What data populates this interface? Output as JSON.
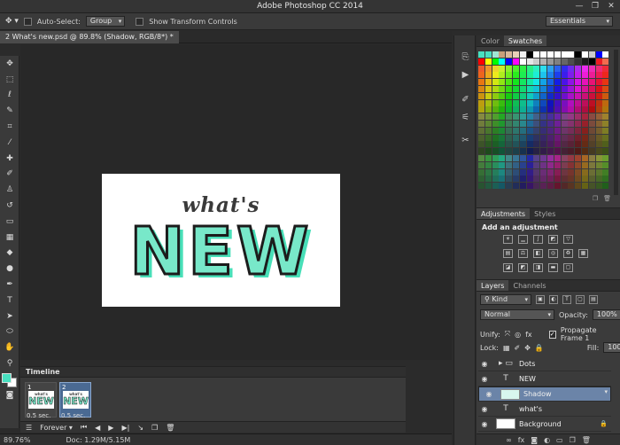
{
  "app": {
    "title": "Adobe Photoshop CC 2014",
    "window_controls": [
      "—",
      "❐",
      "✕"
    ]
  },
  "options_bar": {
    "auto_select_label": "Auto-Select:",
    "auto_select_value": "Group",
    "transform_label": "Show Transform Controls",
    "workspace": "Essentials"
  },
  "document": {
    "tab_label": "2 What's new.psd @ 89.8% (Shadow, RGB/8*) *",
    "art_line1": "what's",
    "art_line2": "NEW"
  },
  "tools": [
    "move-icon",
    "marquee-icon",
    "lasso-icon",
    "quick-select-icon",
    "crop-icon",
    "eyedropper-icon",
    "healing-icon",
    "brush-icon",
    "stamp-icon",
    "history-brush-icon",
    "eraser-icon",
    "gradient-icon",
    "blur-icon",
    "dodge-icon",
    "pen-icon",
    "type-icon",
    "path-select-icon",
    "shape-icon",
    "hand-icon",
    "zoom-icon"
  ],
  "colors": {
    "foreground": "#48e0c0",
    "background": "#ffffff",
    "accent_selected": "#6b84a8"
  },
  "timeline": {
    "title": "Timeline",
    "frames": [
      {
        "num": "1",
        "delay": "0.5 sec.",
        "thumb_top": "what's",
        "thumb_main": "NEW"
      },
      {
        "num": "2",
        "delay": "0.5 sec.",
        "thumb_top": "what's",
        "thumb_main": "NEW"
      }
    ],
    "loop": "Forever"
  },
  "status": {
    "zoom": "89.76%",
    "doc": "Doc: 1.29M/5.15M"
  },
  "color_panel": {
    "tab_color": "Color",
    "tab_swatches": "Swatches"
  },
  "adjustments": {
    "tab_adjustments": "Adjustments",
    "tab_styles": "Styles",
    "heading": "Add an adjustment"
  },
  "layers_panel": {
    "tab_layers": "Layers",
    "tab_channels": "Channels",
    "filter_kind": "Kind",
    "blend_mode": "Normal",
    "opacity_label": "Opacity:",
    "opacity_value": "100%",
    "unify_label": "Unify:",
    "propagate_label": "Propagate Frame 1",
    "lock_label": "Lock:",
    "fill_label": "Fill:",
    "fill_value": "100%",
    "layers": [
      {
        "name": "Dots",
        "kind": "folder"
      },
      {
        "name": "NEW",
        "kind": "text"
      },
      {
        "name": "Shadow",
        "kind": "image",
        "selected": true
      },
      {
        "name": "what's",
        "kind": "text"
      },
      {
        "name": "Background",
        "kind": "image",
        "locked": true
      }
    ]
  }
}
